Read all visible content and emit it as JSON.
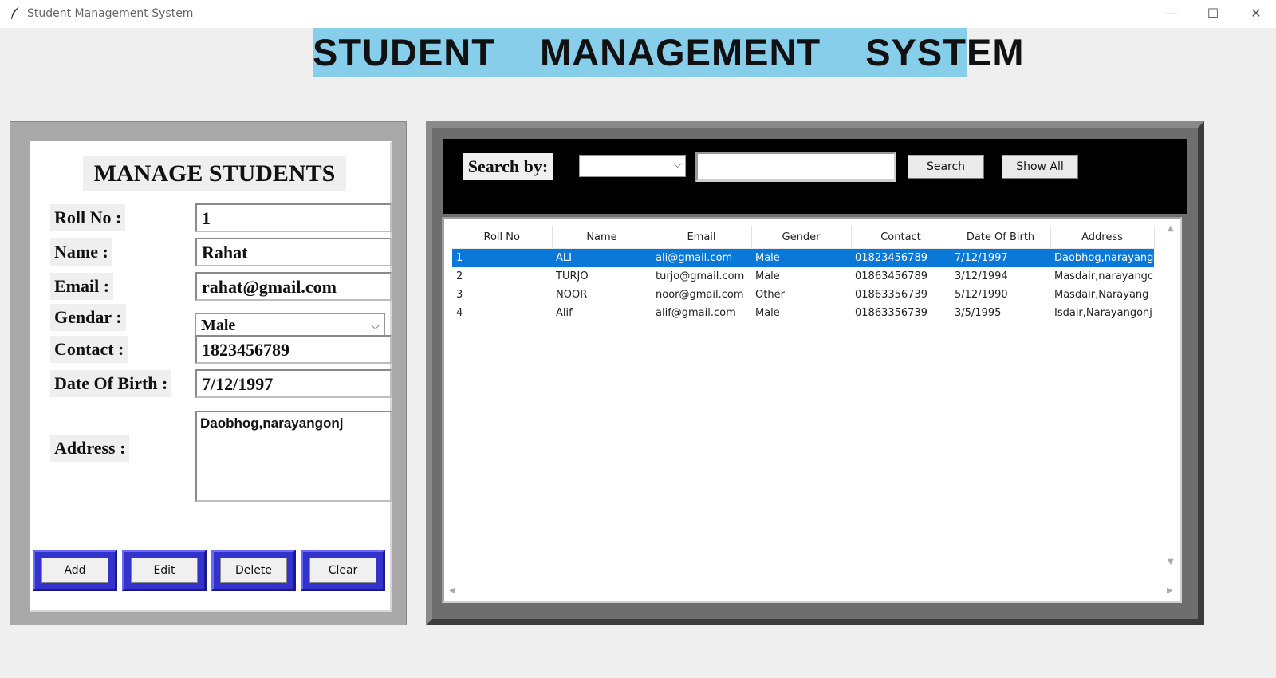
{
  "window": {
    "title": "Student Management System",
    "controls": {
      "minimize": "—",
      "maximize": "☐",
      "close": "✕"
    }
  },
  "header": {
    "title": "STUDENT  MANAGEMENT  SYSTEM",
    "background": "#87ceeb"
  },
  "manage": {
    "heading": "MANAGE STUDENTS",
    "fields": {
      "roll": {
        "label": "Roll No :",
        "value": "1"
      },
      "name": {
        "label": "Name :",
        "value": "Rahat"
      },
      "email": {
        "label": "Email :",
        "value": "rahat@gmail.com"
      },
      "gender": {
        "label": "Gendar :",
        "value": "Male"
      },
      "contact": {
        "label": "Contact :",
        "value": "1823456789"
      },
      "dob": {
        "label": "Date Of Birth :",
        "value": "7/12/1997"
      },
      "address": {
        "label": "Address :",
        "value": "Daobhog,narayangonj"
      }
    },
    "buttons": {
      "add": "Add",
      "edit": "Edit",
      "delete": "Delete",
      "clear": "Clear"
    },
    "button_color": "#3333cc"
  },
  "search": {
    "label": "Search by:",
    "selected": "",
    "query": "",
    "search_button": "Search",
    "show_all_button": "Show All"
  },
  "table": {
    "columns": [
      "Roll No",
      "Name",
      "Email",
      "Gender",
      "Contact",
      "Date Of Birth",
      "Address"
    ],
    "rows": [
      [
        "1",
        "ALI",
        "ali@gmail.com",
        "Male",
        "01823456789",
        "7/12/1997",
        "Daobhog,narayangc"
      ],
      [
        "2",
        "TURJO",
        "turjo@gmail.com",
        "Male",
        "01863456789",
        "3/12/1994",
        "Masdair,narayangc"
      ],
      [
        "3",
        "NOOR",
        "noor@gmail.com",
        "Other",
        "01863356739",
        "5/12/1990",
        "Masdair,Narayang"
      ],
      [
        "4",
        "Alif",
        "alif@gmail.com",
        "Male",
        "01863356739",
        "3/5/1995",
        "Isdair,Narayangonj"
      ]
    ],
    "selected_row": 0,
    "selection_color": "#0a78d7"
  }
}
